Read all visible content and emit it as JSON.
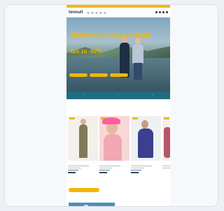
{
  "colors": {
    "accent": "#f2b705",
    "teal_strip": "#1f6c80",
    "link_blue": "#3a7fc4"
  },
  "site": {
    "logo": "tennull"
  },
  "hero": {
    "title": "Sommerschlussverkauf",
    "discount": "Bis zu -50%",
    "subtitle": ""
  },
  "section": {
    "title": ""
  },
  "bottom": {
    "text": ""
  },
  "icons": [
    "search-icon",
    "account-icon",
    "wishlist-icon",
    "cart-icon"
  ]
}
